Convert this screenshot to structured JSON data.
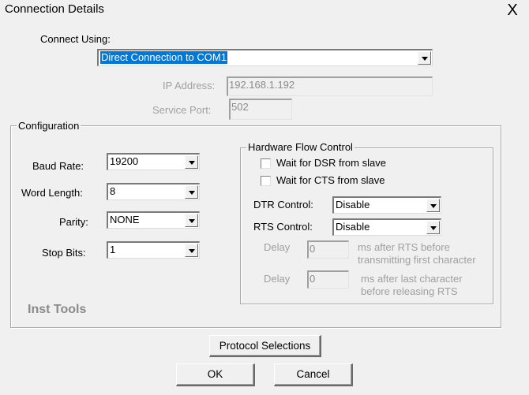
{
  "window": {
    "title": "Connection Details",
    "close_glyph": "X"
  },
  "connect_using": {
    "label": "Connect Using:",
    "selected": "Direct Connection to COM1"
  },
  "ip_address": {
    "label": "IP Address:",
    "value": "192.168.1.192"
  },
  "service_port": {
    "label": "Service Port:",
    "value": "502"
  },
  "configuration": {
    "title": "Configuration",
    "baud_rate": {
      "label": "Baud Rate:",
      "value": "19200"
    },
    "word_length": {
      "label": "Word Length:",
      "value": "8"
    },
    "parity": {
      "label": "Parity:",
      "value": "NONE"
    },
    "stop_bits": {
      "label": "Stop Bits:",
      "value": "1"
    },
    "watermark": "Inst Tools"
  },
  "hardware_flow_control": {
    "title": "Hardware Flow Control",
    "wait_dsr": {
      "label": "Wait for DSR from slave",
      "checked": false
    },
    "wait_cts": {
      "label": "Wait for CTS from slave",
      "checked": false
    },
    "dtr_control": {
      "label": "DTR Control:",
      "value": "Disable"
    },
    "rts_control": {
      "label": "RTS Control:",
      "value": "Disable"
    },
    "delay1": {
      "label": "Delay",
      "value": "0",
      "desc_line1": "ms after RTS before",
      "desc_line2": "transmitting first character"
    },
    "delay2": {
      "label": "Delay",
      "value": "0",
      "desc_line1": "ms after last character",
      "desc_line2": "before releasing RTS"
    }
  },
  "buttons": {
    "protocol_selections": "Protocol Selections",
    "ok": "OK",
    "cancel": "Cancel"
  }
}
